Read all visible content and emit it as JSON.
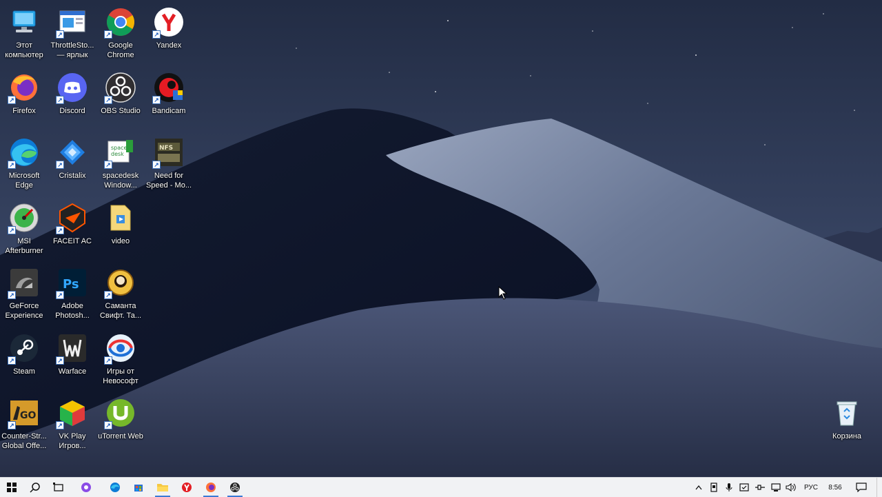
{
  "desktop": {
    "icons": [
      {
        "label": "Этот компьютер",
        "icon": "this-pc-icon"
      },
      {
        "label": "ThrottleSto... — ярлык",
        "icon": "throttlestop-icon"
      },
      {
        "label": "Google Chrome",
        "icon": "chrome-icon"
      },
      {
        "label": "Yandex",
        "icon": "yandex-icon"
      },
      {
        "label": "Firefox",
        "icon": "firefox-icon"
      },
      {
        "label": "Discord",
        "icon": "discord-icon"
      },
      {
        "label": "OBS Studio",
        "icon": "obs-icon"
      },
      {
        "label": "Bandicam",
        "icon": "bandicam-icon"
      },
      {
        "label": "Microsoft Edge",
        "icon": "edge-icon"
      },
      {
        "label": "Cristalix",
        "icon": "cristalix-icon"
      },
      {
        "label": "spacedesk Window...",
        "icon": "spacedesk-icon"
      },
      {
        "label": "Need for Speed - Mo...",
        "icon": "nfs-icon"
      },
      {
        "label": "MSI Afterburner",
        "icon": "msi-afterburner-icon"
      },
      {
        "label": "FACEIT AC",
        "icon": "faceit-icon"
      },
      {
        "label": "video",
        "icon": "folder-video-icon"
      },
      {
        "label": "GeForce Experience",
        "icon": "geforce-icon"
      },
      {
        "label": "Adobe Photosh...",
        "icon": "photoshop-icon"
      },
      {
        "label": "Саманта Свифт. Та...",
        "icon": "samantha-icon"
      },
      {
        "label": "Steam",
        "icon": "steam-icon"
      },
      {
        "label": "Warface",
        "icon": "warface-icon"
      },
      {
        "label": "Игры от Невософт",
        "icon": "nevosoft-icon"
      },
      {
        "label": "Counter-Str... Global Offe...",
        "icon": "csgo-icon"
      },
      {
        "label": "VK Play Игров...",
        "icon": "vkplay-icon"
      },
      {
        "label": "uTorrent Web",
        "icon": "utorrent-icon"
      }
    ],
    "recycle_bin": {
      "label": "Корзина",
      "icon": "recycle-bin-icon"
    }
  },
  "taskbar": {
    "language": "РУС",
    "time": "8:56"
  },
  "colors": {
    "taskbar_bg": "#f1f2f4",
    "accent": "#3a7ad6"
  }
}
